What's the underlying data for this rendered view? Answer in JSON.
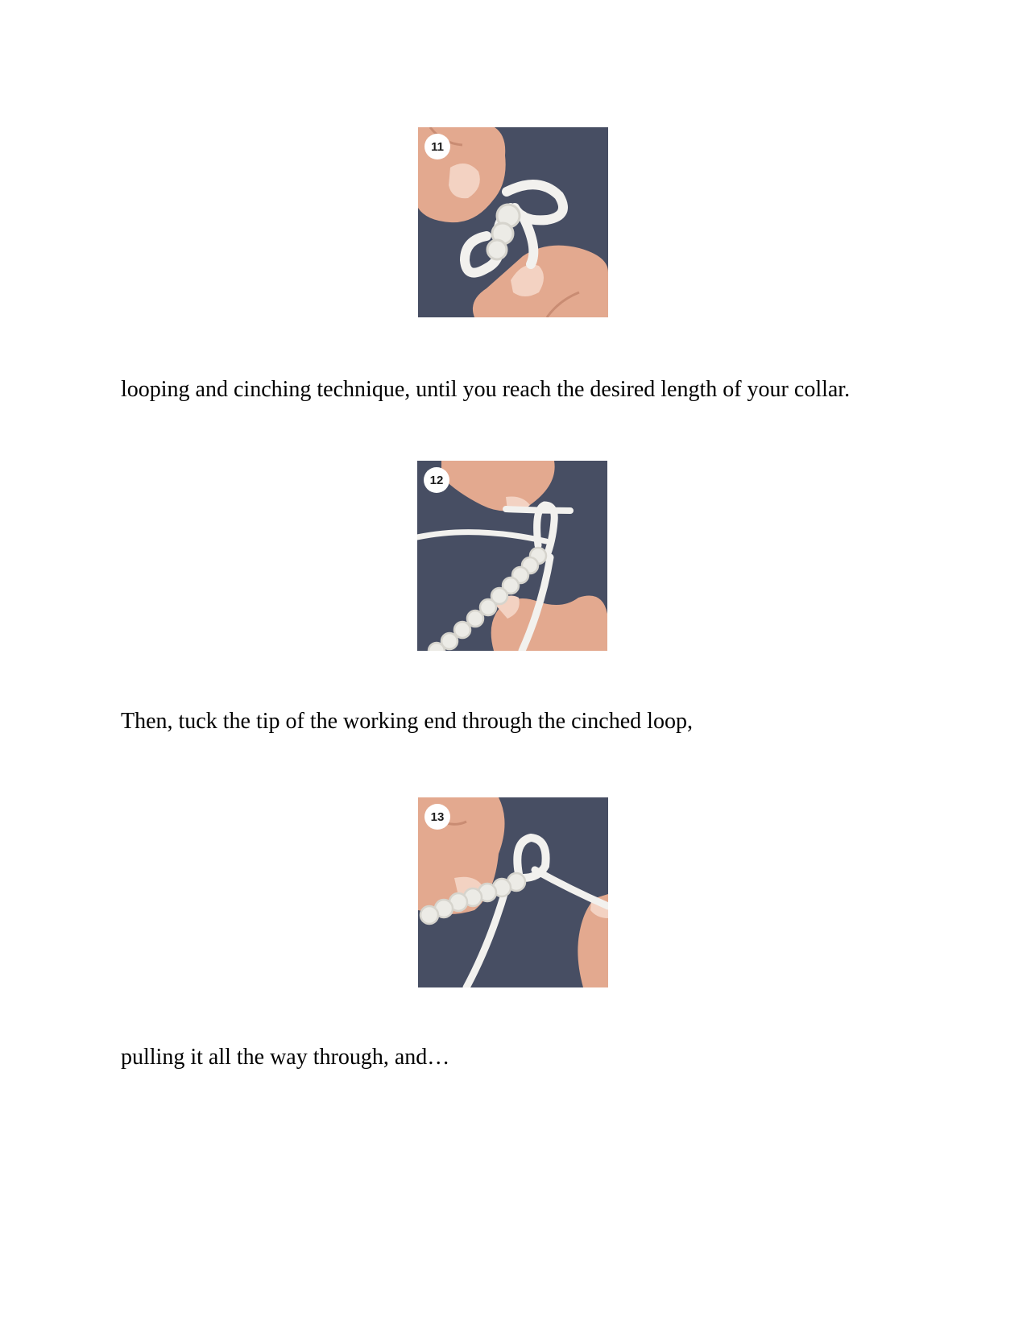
{
  "steps": [
    {
      "badge": "11",
      "caption": "looping and cinching technique, until you reach the desired length of your collar."
    },
    {
      "badge": "12",
      "caption": "Then, tuck the tip of the working end through the cinched loop,"
    },
    {
      "badge": "13",
      "caption": "pulling it all the way through, and…"
    }
  ],
  "colors": {
    "photo_background": "#474e63",
    "cord": "#f2f1ee",
    "skin": "#e9b7a0",
    "badge": "#ffffff"
  }
}
